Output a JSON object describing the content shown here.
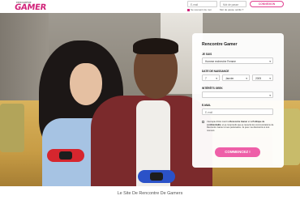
{
  "header": {
    "logo_small": "rencontre",
    "logo_big": "GAMER",
    "email_placeholder": "E-mail",
    "password_placeholder": "Mot de passe",
    "login_button": "CONNEXION",
    "remember_label": "Se souvenir de moi",
    "forgot_label": "Mot de passe oublié ?"
  },
  "signup": {
    "title": "Rencontre Gamer",
    "i_am_label": "JE SUIS",
    "i_am_value": "Homme recherche Femme",
    "birthdate_label": "DATE DE NAISSANCE",
    "day": "7",
    "month": "Janvier",
    "year": "2005",
    "interested_label": "INTÉRÊTS GEEK",
    "interested_value": "",
    "email_label": "E-MAIL",
    "email_placeholder": "E-mail",
    "terms_prefix": "J'accepte d'être inscrit à ",
    "terms_link1": "Rencontre Gamer",
    "terms_mid1": " et la ",
    "terms_link2": "Politique de confidentialité",
    "terms_mid2": ", et je comprends que je recevrai les communications de Rencontre Gamer et ses partenaires. Je peux me désinscrire à tout moment.",
    "submit_button": "COMMENCEZ !"
  },
  "footer": {
    "tagline": "Le Site De Rencontre De Gamers"
  },
  "colors": {
    "brand_pink": "#d1247a",
    "button_pink": "#ee5fa8"
  }
}
